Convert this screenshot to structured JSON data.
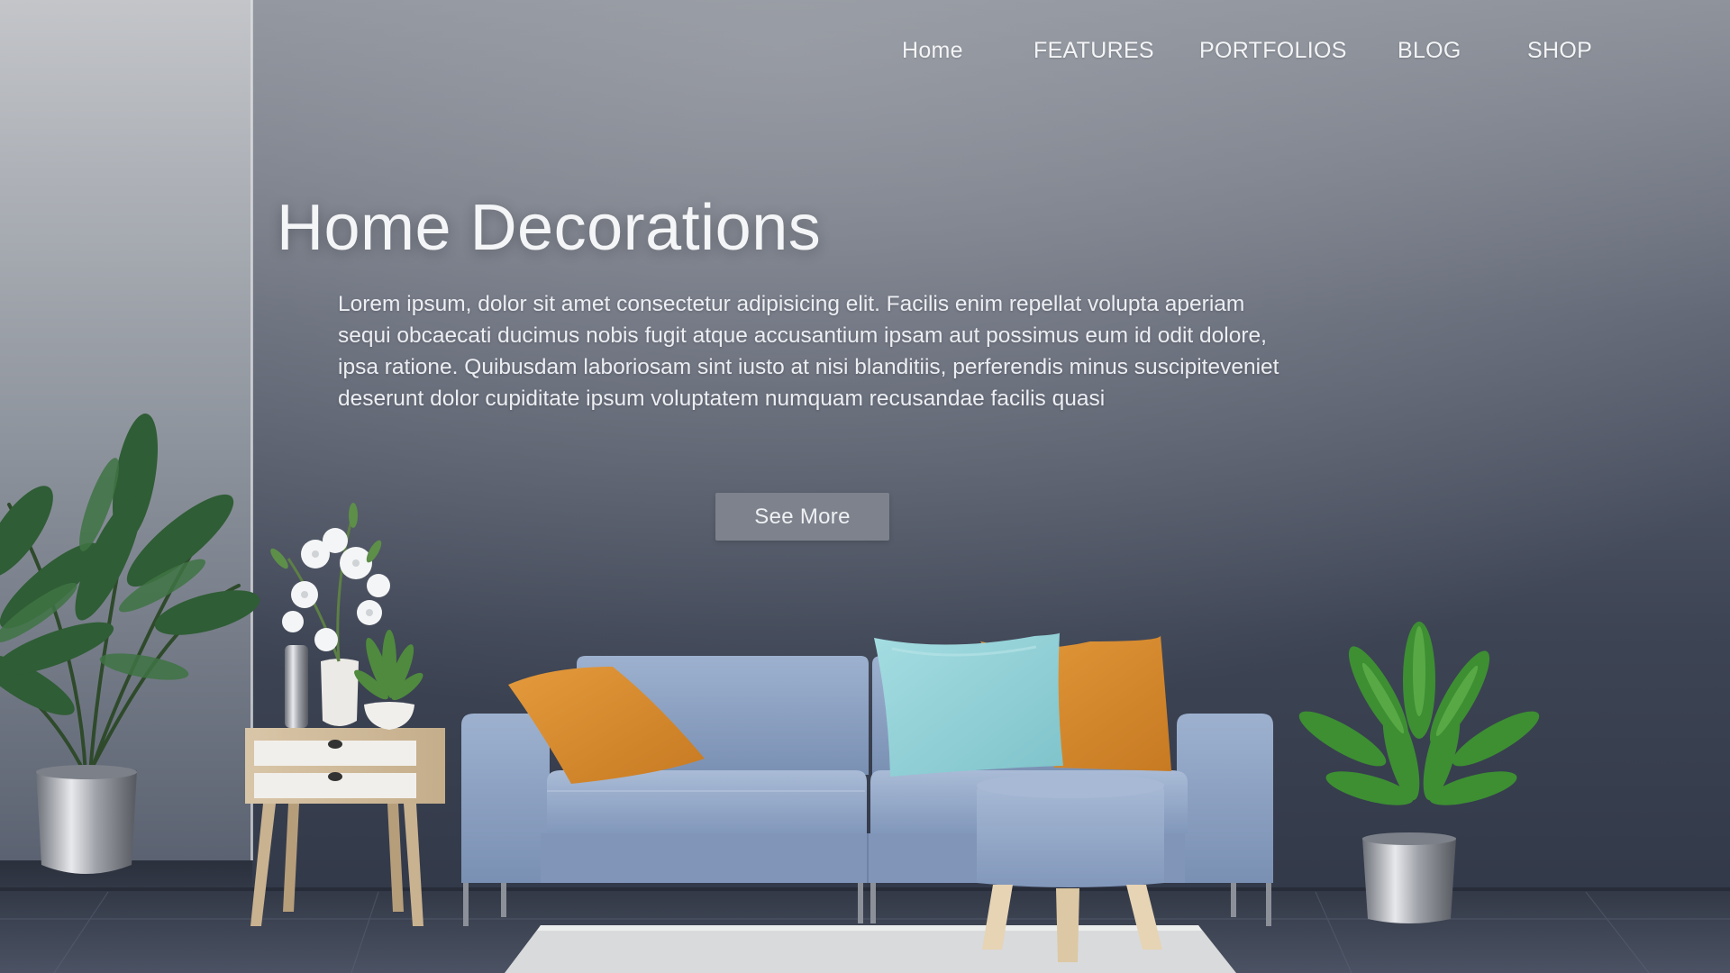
{
  "nav": {
    "items": [
      {
        "label": "Home"
      },
      {
        "label": "FEATURES"
      },
      {
        "label": "PORTFOLIOS"
      },
      {
        "label": "BLOG"
      },
      {
        "label": "SHOP"
      }
    ]
  },
  "hero": {
    "title": "Home Decorations",
    "body": "Lorem ipsum, dolor sit amet consectetur adipisicing elit. Facilis    enim repellat volupta aperiam sequi obcaecati ducimus nobis fugit atque accusantium ipsam aut possimus eum id odit dolore, ipsa ratione. Quibusdam laboriosam sint iusto at nisi blanditiis, perferendis minus suscipiteveniet deserunt dolor cupiditate ipsum voluptatem numquam recusandae facilis quasi",
    "button_label": "See More"
  },
  "colors": {
    "wall_dark": "#353c4b",
    "wall_light": "#b9bbbf",
    "sofa": "#8fa5c6",
    "pillow_orange": "#d98a2b",
    "pillow_teal": "#8fd0d6",
    "button": "#7d828c"
  }
}
